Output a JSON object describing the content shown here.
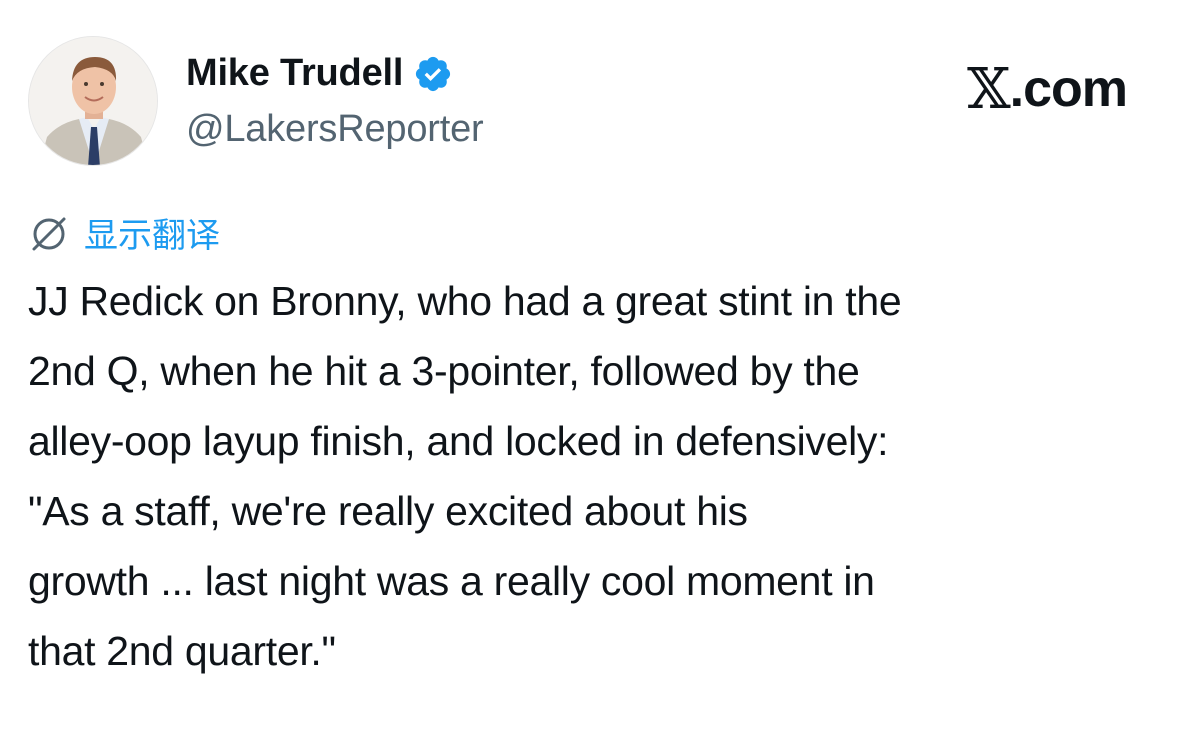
{
  "author": {
    "display_name": "Mike Trudell",
    "handle": "@LakersReporter",
    "verified": true,
    "avatar_icon": "profile-photo"
  },
  "brand": {
    "x_mark": "𝕏",
    "suffix": ".com"
  },
  "translate": {
    "icon": "globe-slash-icon",
    "label": "显示翻译"
  },
  "tweet": {
    "text": "JJ Redick on Bronny, who had a great stint in the\n2nd Q, when he hit a 3-pointer, followed by the\nalley-oop layup finish, and locked in defensively:\n\"As a staff, we're really excited about his\ngrowth ... last night was a really cool moment in\nthat 2nd quarter.\""
  },
  "colors": {
    "accent": "#1d9bf0",
    "text": "#0f1419",
    "secondary": "#536471"
  }
}
